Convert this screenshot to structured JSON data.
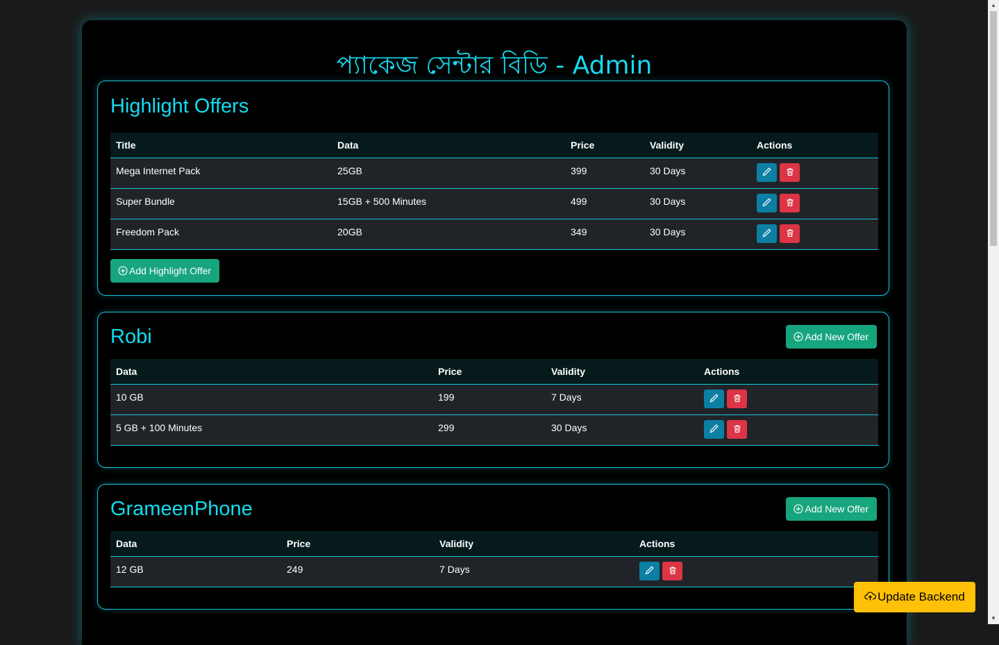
{
  "header": {
    "title": "প্যাকেজ সেন্টার বিডি - Admin"
  },
  "highlight": {
    "title": "Highlight Offers",
    "columns": [
      "Title",
      "Data",
      "Price",
      "Validity",
      "Actions"
    ],
    "rows": [
      {
        "title": "Mega Internet Pack",
        "data": "25GB",
        "price": "399",
        "validity": "30 Days"
      },
      {
        "title": "Super Bundle",
        "data": "15GB + 500 Minutes",
        "price": "499",
        "validity": "30 Days"
      },
      {
        "title": "Freedom Pack",
        "data": "20GB",
        "price": "349",
        "validity": "30 Days"
      }
    ],
    "add_label": "Add Highlight Offer"
  },
  "robi": {
    "title": "Robi",
    "add_label": "Add New Offer",
    "columns": [
      "Data",
      "Price",
      "Validity",
      "Actions"
    ],
    "rows": [
      {
        "data": "10 GB",
        "price": "199",
        "validity": "7 Days"
      },
      {
        "data": "5 GB + 100 Minutes",
        "price": "299",
        "validity": "30 Days"
      }
    ]
  },
  "gp": {
    "title": "GrameenPhone",
    "add_label": "Add New Offer",
    "columns": [
      "Data",
      "Price",
      "Validity",
      "Actions"
    ],
    "rows": [
      {
        "data": "12 GB",
        "price": "249",
        "validity": "7 Days"
      }
    ]
  },
  "footer": {
    "update_label": "Update Backend"
  },
  "colors": {
    "accent": "#14dcef",
    "edit": "#0c7fa3",
    "delete": "#dc3545",
    "add": "#17a57e",
    "update": "#ffc107"
  },
  "icons": {
    "edit": "pencil-icon",
    "delete": "trash-icon",
    "add": "plus-circle-icon",
    "update": "cloud-upload-icon"
  }
}
